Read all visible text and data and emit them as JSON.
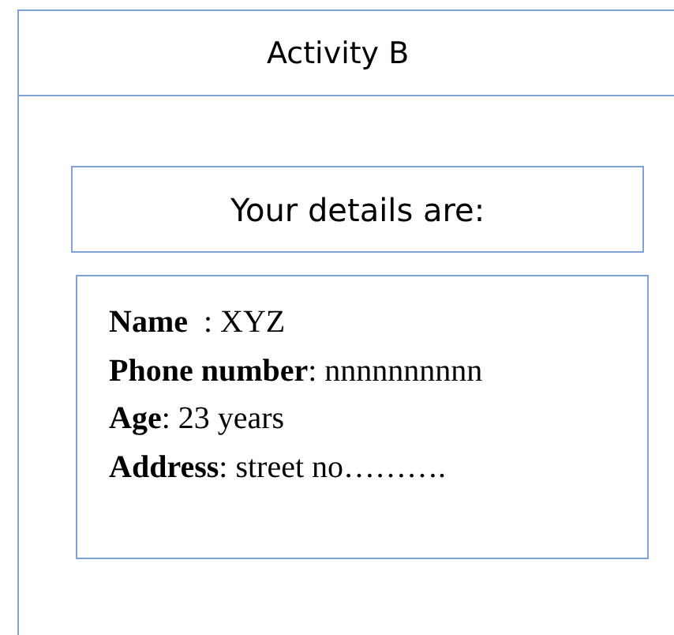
{
  "header": {
    "title": "Activity B"
  },
  "heading": {
    "text": "Your details are:"
  },
  "details": [
    {
      "text": "**Name**  : XYZ"
    },
    {
      "text": "**Phone number**: nnnnnnnnnn"
    },
    {
      "text": "**Age**: 23 years"
    },
    {
      "text": "**Address**: street no………."
    }
  ]
}
